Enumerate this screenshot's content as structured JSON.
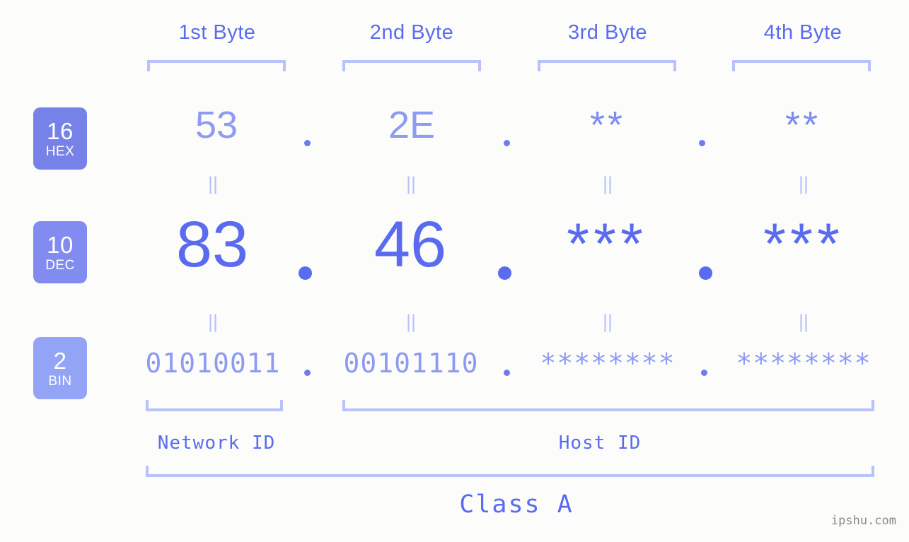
{
  "page": {
    "background_color": "#fcfdfa",
    "accent_color": "#5a6bef",
    "accent_light_color": "#8d9bf2",
    "bracket_color": "#b9c2fa"
  },
  "headers": [
    {
      "label": "1st Byte"
    },
    {
      "label": "2nd Byte"
    },
    {
      "label": "3rd Byte"
    },
    {
      "label": "4th Byte"
    }
  ],
  "radix_badges": [
    {
      "number": "16",
      "unit": "HEX",
      "color": "#7782e8"
    },
    {
      "number": "10",
      "unit": "DEC",
      "color": "#828cf0"
    },
    {
      "number": "2",
      "unit": "BIN",
      "color": "#93a3f5"
    }
  ],
  "rows": {
    "hex": {
      "octets": [
        "53",
        "2E",
        "**",
        "**"
      ],
      "separator": "."
    },
    "dec": {
      "octets": [
        "83",
        "46",
        "***",
        "***"
      ],
      "separator": "."
    },
    "bin": {
      "octets": [
        "01010011",
        "00101110",
        "********",
        "********"
      ],
      "separator": "."
    }
  },
  "equals_marker": "||",
  "regions": [
    {
      "name": "Network ID"
    },
    {
      "name": "Host ID"
    }
  ],
  "class": {
    "label": "Class A"
  },
  "watermark": {
    "text": "ipshu.com"
  }
}
